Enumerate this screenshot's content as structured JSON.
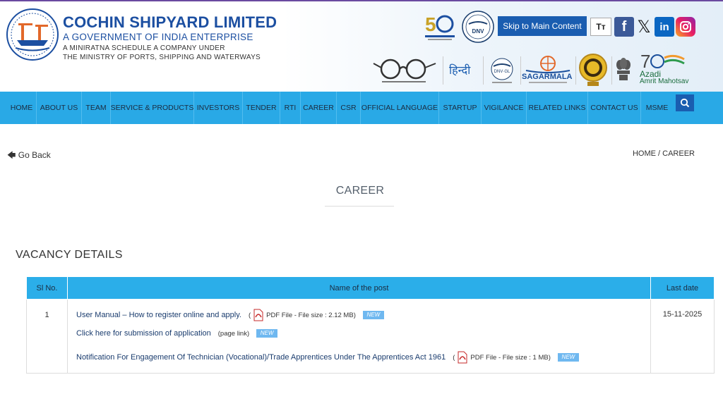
{
  "header": {
    "title": "COCHIN SHIPYARD LIMITED",
    "subtitle": "A GOVERNMENT OF INDIA ENTERPRISE",
    "line1": "A MINIRATNA SCHEDULE A COMPANY UNDER",
    "line2": "THE MINISTRY OF PORTS, SHIPPING AND WATERWAYS",
    "skip_label": "Skip to Main Content",
    "text_size_label": "Tт",
    "hindi_label": "हिन्दी",
    "sagarmala_label": "SAGARMALA",
    "azadi_label": "Azadi",
    "mahotsav_label": "Amrit Mahotsav",
    "accent_color": "#1c4fa1"
  },
  "nav": {
    "items": [
      {
        "label": "HOME"
      },
      {
        "label": "ABOUT US"
      },
      {
        "label": "TEAM"
      },
      {
        "label": "SERVICE & PRODUCTS"
      },
      {
        "label": "INVESTORS"
      },
      {
        "label": "TENDER"
      },
      {
        "label": "RTI"
      },
      {
        "label": "CAREER"
      },
      {
        "label": "CSR"
      },
      {
        "label": "OFFICIAL LANGUAGE"
      },
      {
        "label": "STARTUP"
      },
      {
        "label": "VIGILANCE"
      },
      {
        "label": "RELATED LINKS"
      },
      {
        "label": "CONTACT US"
      },
      {
        "label": "MSME"
      }
    ],
    "search_icon": "search-icon",
    "bar_color": "#29a9e6"
  },
  "page": {
    "go_back": "Go Back",
    "breadcrumb": "HOME / CAREER",
    "title": "CAREER",
    "section_title": "VACANCY DETAILS"
  },
  "table": {
    "headers": [
      "Sl No.",
      "Name of the post",
      "Last date"
    ],
    "rows": [
      {
        "sl": "1",
        "last_date": "15-11-2025",
        "items": [
          {
            "text": "User Manual – How to register online and apply.",
            "meta": "PDF File -  File size : 2.12 MB",
            "new": "NEW"
          },
          {
            "text": "Click here for submission of application",
            "meta": "(page link)",
            "new": "NEW"
          },
          {
            "text": "Notification For Engagement Of Technician (Vocational)/Trade Apprentices Under The Apprentices Act 1961",
            "meta": "PDF File -  File size : 1 MB",
            "new": "NEW"
          }
        ]
      }
    ]
  }
}
